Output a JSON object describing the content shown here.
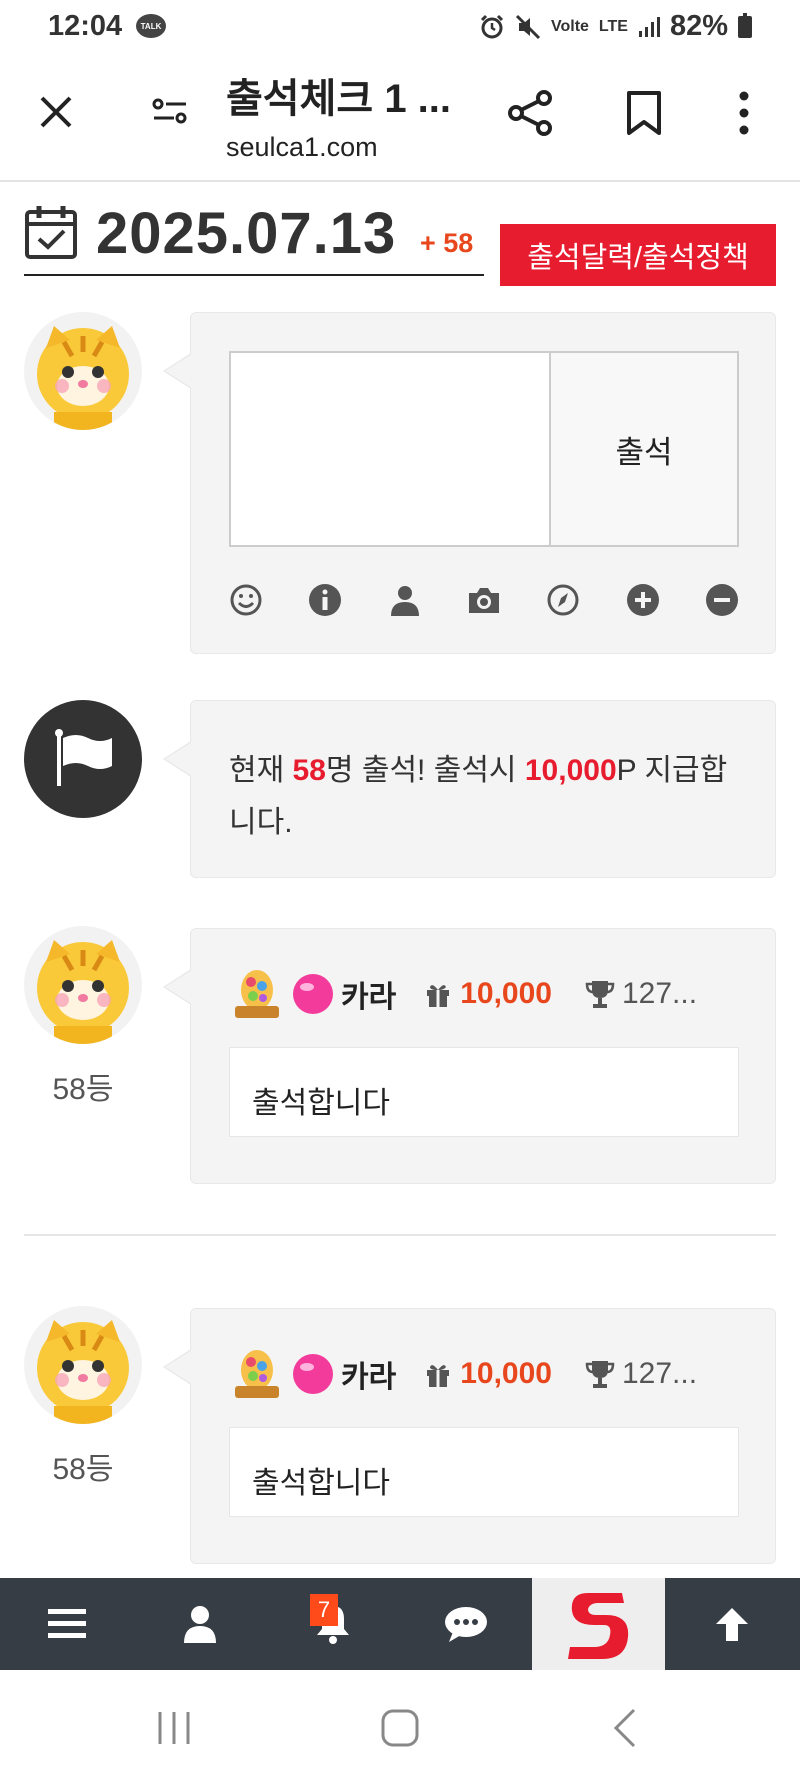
{
  "status_bar": {
    "time": "12:04",
    "talk_badge": "TALK",
    "volte": "Volte",
    "lte": "LTE",
    "battery": "82%"
  },
  "browser": {
    "title": "출석체크 1 ...",
    "url": "seulca1.com"
  },
  "attendance": {
    "date": "2025.07.13",
    "plus_count": "+ 58",
    "policy_button": "출석달력/출석정책",
    "attend_button": "출석",
    "notice": {
      "prefix": "현재 ",
      "count": "58",
      "middle": "명 출석! 출석시 ",
      "points": "10,000",
      "suffix": "P 지급합니다."
    }
  },
  "entries": [
    {
      "rank": "58등",
      "nickname": "카라",
      "points": "10,000",
      "count": "127...",
      "message": "출석합니다"
    },
    {
      "rank": "58등",
      "nickname": "카라",
      "points": "10,000",
      "count": "127...",
      "message": "출석합니다"
    }
  ],
  "bottom_nav": {
    "notification_count": "7"
  },
  "colors": {
    "accent_red": "#e81c2f",
    "points_orange": "#e8471d",
    "nav_bg": "#373d45"
  },
  "icons": [
    "close-icon",
    "filter-icon",
    "share-icon",
    "bookmark-icon",
    "more-icon",
    "calendar-check-icon",
    "smile-icon",
    "info-icon",
    "user-icon",
    "camera-icon",
    "compass-icon",
    "plus-circle-icon",
    "minus-circle-icon",
    "flag-icon",
    "gift-icon",
    "trophy-icon",
    "menu-icon",
    "bell-icon",
    "chat-icon",
    "arrow-up-icon"
  ]
}
